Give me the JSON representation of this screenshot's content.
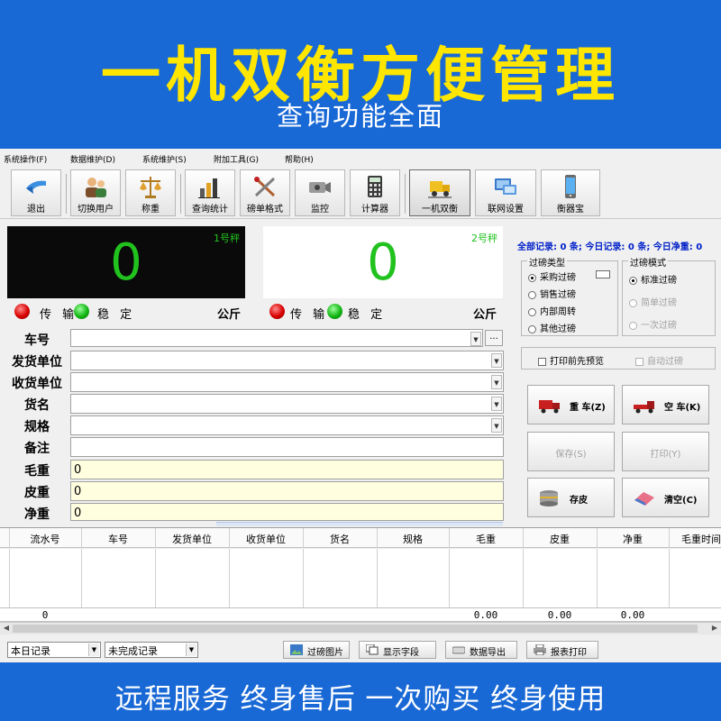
{
  "banner": {
    "headline": "一机双衡方便管理",
    "subheadline": "查询功能全面",
    "slogan": "远程服务 终身售后 一次购买 终身使用",
    "headline_color": "#ffe600",
    "background_color": "#1868d6"
  },
  "menu": [
    "系统操作(F)",
    "数据维护(D)",
    "系统维护(S)",
    "附加工具(G)",
    "帮助(H)"
  ],
  "toolbar": [
    {
      "label": "退出",
      "icon": "exit-arrow-icon"
    },
    {
      "label": "切换用户",
      "icon": "switch-user-icon"
    },
    {
      "label": "称重",
      "icon": "scale-icon"
    },
    {
      "label": "查询统计",
      "icon": "chart-icon"
    },
    {
      "label": "磅单格式",
      "icon": "tools-icon"
    },
    {
      "label": "监控",
      "icon": "camera-icon"
    },
    {
      "label": "计算器",
      "icon": "calculator-icon"
    },
    {
      "label": "一机双衡",
      "icon": "truck-scale-icon"
    },
    {
      "label": "联网设置",
      "icon": "network-icon"
    },
    {
      "label": "衡器宝",
      "icon": "phone-icon"
    }
  ],
  "scales": [
    {
      "label": "1号秤",
      "value": "0",
      "transmit": "传 输",
      "stable": "稳 定",
      "unit": "公斤"
    },
    {
      "label": "2号秤",
      "value": "0",
      "transmit": "传 输",
      "stable": "稳 定",
      "unit": "公斤"
    }
  ],
  "form": {
    "labels": {
      "plate": "车号",
      "sender": "发货单位",
      "receiver": "收货单位",
      "goods": "货名",
      "spec": "规格",
      "remark": "备注",
      "gross": "毛重",
      "tare": "皮重",
      "net": "净重"
    },
    "values": {
      "gross": "0",
      "tare": "0",
      "net": "0"
    },
    "ellipsis": "..."
  },
  "summary": "全部记录: 0 条; 今日记录: 0 条; 今日净重: 0",
  "weigh_type": {
    "title": "过磅类型",
    "options": [
      "采购过磅",
      "销售过磅",
      "内部周转",
      "其他过磅"
    ],
    "selected": 0
  },
  "weigh_mode": {
    "title": "过磅模式",
    "options": [
      "标准过磅",
      "简单过磅",
      "一次过磅"
    ],
    "selected": 0
  },
  "checks": {
    "preview": "打印前先预览",
    "auto": "自动过磅"
  },
  "actions": {
    "heavy": "重 车(Z)",
    "empty": "空 车(K)",
    "save": "保存(S)",
    "print": "打印(Y)",
    "store_tare": "存皮",
    "clear": "清空(C)"
  },
  "grid": {
    "columns": [
      "流水号",
      "车号",
      "发货单位",
      "收货单位",
      "货名",
      "规格",
      "毛重",
      "皮重",
      "净重",
      "毛重时间"
    ],
    "totals": {
      "serial": "0",
      "gross": "0.00",
      "tare": "0.00",
      "net": "0.00"
    }
  },
  "bottom": {
    "filter_date": "本日记录",
    "filter_status": "未完成记录",
    "buttons": [
      {
        "label": "过磅图片",
        "icon": "picture-icon"
      },
      {
        "label": "显示字段",
        "icon": "columns-icon"
      },
      {
        "label": "数据导出",
        "icon": "export-icon"
      },
      {
        "label": "报表打印",
        "icon": "printer-icon"
      }
    ]
  }
}
